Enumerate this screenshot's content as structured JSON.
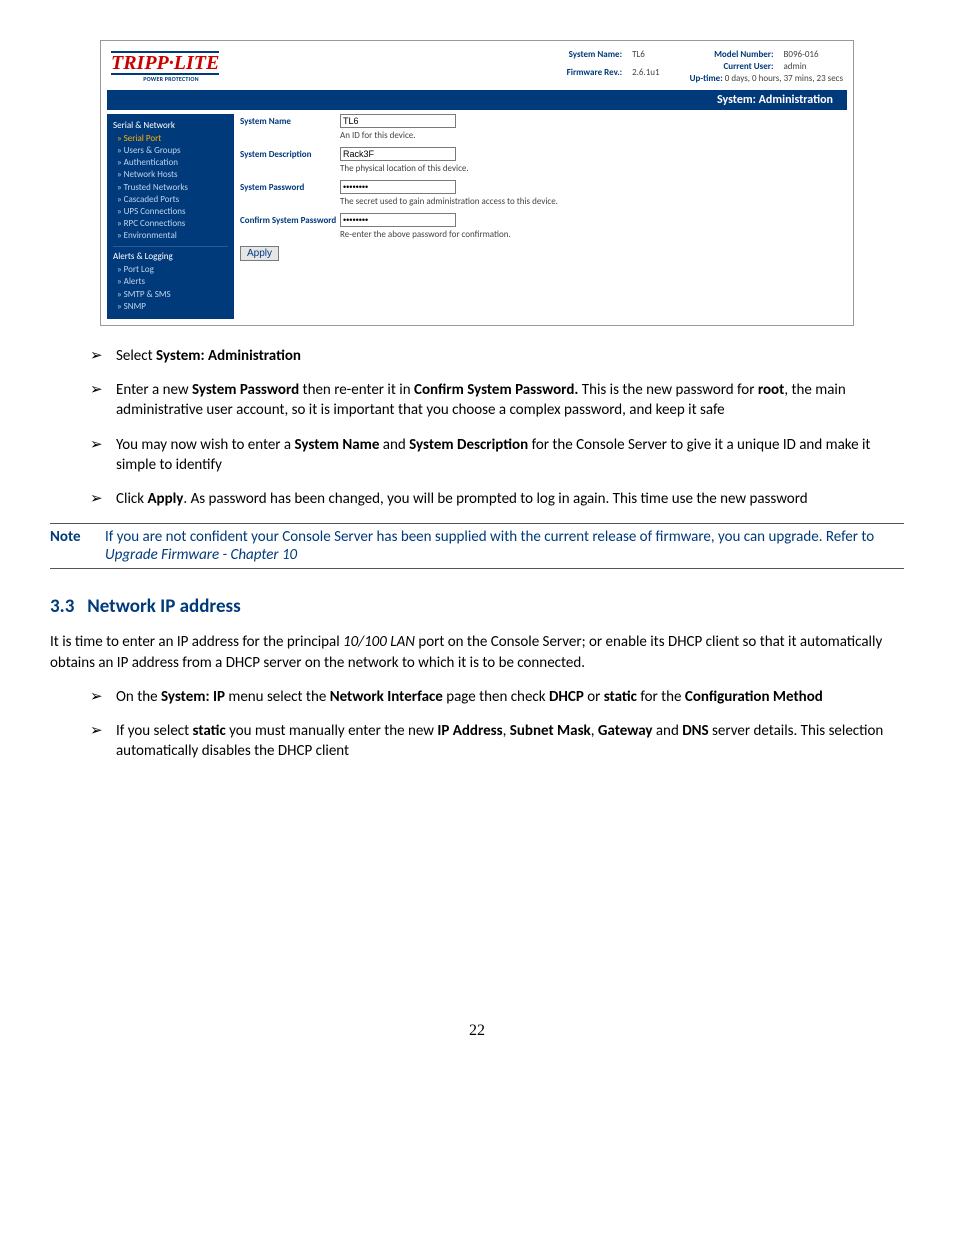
{
  "screenshot": {
    "logo": {
      "brand": "TRIPP·LITE",
      "tagline": "POWER PROTECTION"
    },
    "header_left": {
      "system_name_label": "System Name:",
      "system_name_value": "TL6",
      "firmware_label": "Firmware Rev.:",
      "firmware_value": "2.6.1u1"
    },
    "header_right": {
      "model_label": "Model Number:",
      "model_value": "B096-016",
      "user_label": "Current User:",
      "user_value": "admin",
      "uptime_label": "Up-time:",
      "uptime_value": "0 days, 0 hours, 37 mins, 23 secs"
    },
    "titlebar": "System: Administration",
    "sidebar": {
      "group1_title": "Serial & Network",
      "group1_items": [
        "Serial Port",
        "Users & Groups",
        "Authentication",
        "Network Hosts",
        "Trusted Networks",
        "Cascaded Ports",
        "UPS Connections",
        "RPC Connections",
        "Environmental"
      ],
      "group2_title": "Alerts & Logging",
      "group2_items": [
        "Port Log",
        "Alerts",
        "SMTP & SMS",
        "SNMP"
      ],
      "active_index": 0
    },
    "form": {
      "rows": [
        {
          "label": "System Name",
          "value": "TL6",
          "type": "text",
          "help": "An ID for this device."
        },
        {
          "label": "System Description",
          "value": "Rack3F",
          "type": "text",
          "help": "The physical location of this device."
        },
        {
          "label": "System Password",
          "value": "••••••••",
          "type": "password",
          "help": "The secret used to gain administration access to this device."
        },
        {
          "label": "Confirm System Password",
          "value": "••••••••",
          "type": "password",
          "help": "Re-enter the above password for confirmation."
        }
      ],
      "apply_label": "Apply"
    }
  },
  "doc": {
    "bullets1": [
      {
        "pre": "Select ",
        "b1": "System: Administration",
        "post": ""
      },
      {
        "pre": "Enter a new ",
        "b1": "System Password",
        "mid1": " then re-enter it in ",
        "b2": "Confirm System Password.",
        "post": " This is the new password for ",
        "b3": "root",
        "tail": ", the main administrative user account, so it is important that you choose a complex password, and keep it safe"
      },
      {
        "pre": "You may now wish to enter a ",
        "b1": "System Name",
        "mid1": " and ",
        "b2": "System Description",
        "post": " for the Console Server to give it a unique ID and make it simple to identify"
      },
      {
        "pre": "Click ",
        "b1": "Apply",
        "post": ". As password has been changed, you will be prompted to log in again. This time use the new password"
      }
    ],
    "note_label": "Note",
    "note_text_pre": "If you are not confident your Console Server has been supplied with the current release of firmware, you can upgrade. Refer to ",
    "note_text_em": "Upgrade Firmware - Chapter 10",
    "section_no": "3.3",
    "section_title": "Network IP address",
    "para1_pre": "It is time to enter an IP address for the principal ",
    "para1_em": "10/100 LAN",
    "para1_post": " port on the Console Server; or enable its DHCP client so that it automatically obtains an IP address from a DHCP server on the network to which it is to be connected.",
    "bullets2": [
      {
        "pre": "On the ",
        "b1": "System: IP",
        "mid1": " menu select the ",
        "b2": "Network Interface",
        "mid2": "  page then check ",
        "b3": "DHCP",
        "mid3": " or ",
        "b4": "static",
        "post": " for the ",
        "b5": "Configuration Method"
      },
      {
        "pre": "If you select ",
        "b1": "static",
        "mid1": " you must manually enter the new ",
        "b2": "IP Address",
        "mid2": ", ",
        "b3": "Subnet Mask",
        "mid3": ", ",
        "b4": "Gateway",
        "post": " and ",
        "b5": "DNS",
        "tail": " server details. This selection automatically disables the DHCP client"
      }
    ],
    "page_number": "22"
  }
}
